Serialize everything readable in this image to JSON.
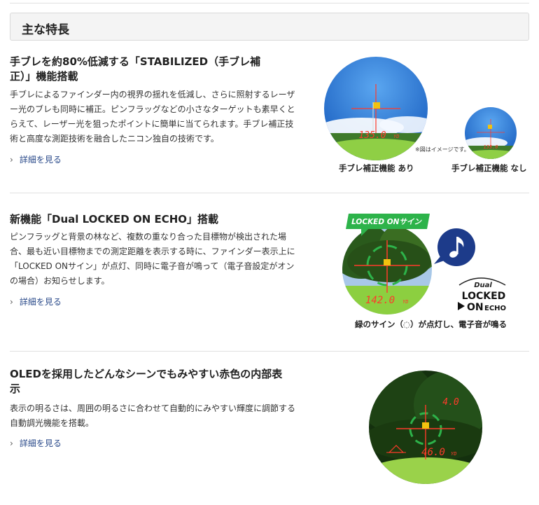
{
  "header": {
    "title": "主な特長"
  },
  "sections": [
    {
      "title_line1": "手ブレを約80%低減する「STABILIZED（手ブレ補",
      "title_line2": "正）」機能搭載",
      "body_lines": [
        "手ブレによるファインダー内の視界の揺れを低減し、さらに照射するレーザ",
        "ー光のブレも同時に補正。ピンフラッグなどの小さなターゲットも素早くと",
        "らえて、レーザー光を狙ったポイントに簡単に当てられます。手ブレ補正技",
        "術と高度な測距技術を融合したニコン独自の技術です。"
      ],
      "more_label": "詳細を見る",
      "image": {
        "reading_large": "135.0",
        "reading_small": "135.0",
        "unit": "YD",
        "note": "※図はイメージです。",
        "caption_on_prefix": "手ブレ補正機能 ",
        "caption_on_strong": "あり",
        "caption_off_prefix": "手ブレ補正機能 ",
        "caption_off_strong": "なし"
      }
    },
    {
      "title_line1": "新機能「Dual LOCKED ON ECHO」搭載",
      "body_lines": [
        "ピンフラッグと背景の林など、複数の重なり合った目標物が検出された場",
        "合、最も近い目標物までの測定距離を表示する時に、ファインダー表示上に",
        "「LOCKED ONサイン」が点灯、同時に電子音が鳴って（電子音設定がオン",
        "の場合）お知らせします。"
      ],
      "more_label": "詳細を見る",
      "image": {
        "banner": "LOCKED ONサイン",
        "reading": "142.0",
        "unit": "YD",
        "logo_dual": "Dual",
        "logo_locked": "LOCKED",
        "logo_on": "ON",
        "logo_echo": "ECHO",
        "caption": "緑のサイン（◌）が点灯し、電子音が鳴る"
      }
    },
    {
      "title_line1": "OLEDを採用したどんなシーンでもみやすい赤色の内部表",
      "title_line2": "示",
      "body_lines": [
        "表示の明るさは、周囲の明るさに合わせて自動的にみやすい輝度に調節する",
        "自動調光機能を搭載。"
      ],
      "more_label": "詳細を見る",
      "image": {
        "reading_top": "4.0",
        "reading": "46.0",
        "unit": "YD"
      }
    }
  ],
  "colors": {
    "sky": "#2f78d6",
    "grass": "#7cc23a",
    "forest": "#1f4a17",
    "display_red": "#ff3a2a",
    "lock_green": "#2db34a",
    "note_navy": "#1d3b8a",
    "link": "#2a4a8a"
  }
}
